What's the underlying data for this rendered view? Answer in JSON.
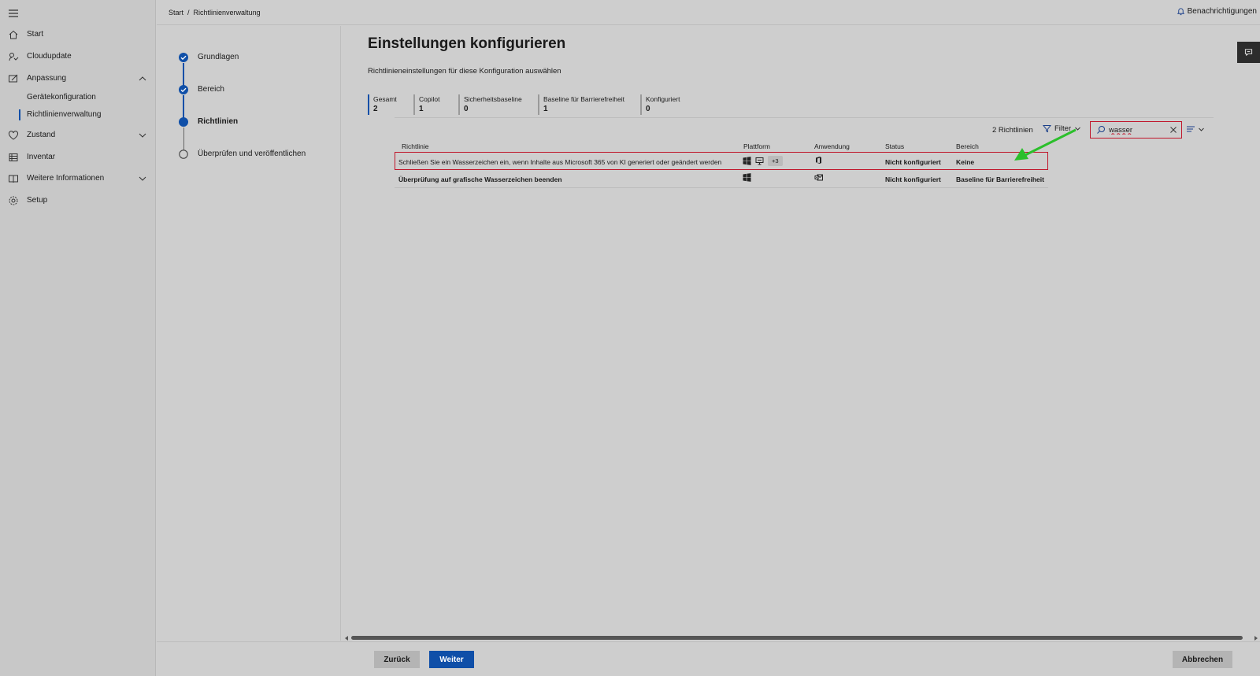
{
  "nav": {
    "items": [
      {
        "label": "Start",
        "icon": "home-icon"
      },
      {
        "label": "Cloudupdate",
        "icon": "cloud-update-icon"
      },
      {
        "label": "Anpassung",
        "icon": "customize-icon",
        "expanded": true
      },
      {
        "label": "Zustand",
        "icon": "health-icon",
        "expanded": false
      },
      {
        "label": "Inventar",
        "icon": "inventory-icon"
      },
      {
        "label": "Weitere Informationen",
        "icon": "book-icon",
        "expanded": false
      },
      {
        "label": "Setup",
        "icon": "gear-icon"
      }
    ],
    "subitems": [
      {
        "label": "Gerätekonfiguration"
      },
      {
        "label": "Richtlinienverwaltung",
        "selected": true
      }
    ]
  },
  "header": {
    "breadcrumb": [
      "Start",
      "Richtlinienverwaltung"
    ],
    "breadcrumb_sep": "/",
    "notifications_label": "Benachrichtigungen"
  },
  "steps": [
    {
      "label": "Grundlagen",
      "state": "done"
    },
    {
      "label": "Bereich",
      "state": "done"
    },
    {
      "label": "Richtlinien",
      "state": "current"
    },
    {
      "label": "Überprüfen und veröffentlichen",
      "state": "pending"
    }
  ],
  "main": {
    "title": "Einstellungen konfigurieren",
    "subtitle": "Richtlinieneinstellungen für diese Konfiguration auswählen",
    "tabs": [
      {
        "label": "Gesamt",
        "count": "2",
        "active": true
      },
      {
        "label": "Copilot",
        "count": "1"
      },
      {
        "label": "Sicherheitsbaseline",
        "count": "0"
      },
      {
        "label": "Baseline für Barrierefreiheit",
        "count": "1"
      },
      {
        "label": "Konfiguriert",
        "count": "0"
      }
    ],
    "toolbar": {
      "count_label": "2 Richtlinien",
      "filter_label": "Filter",
      "search_value": "wasser"
    },
    "table": {
      "headers": [
        "Richtlinie",
        "Plattform",
        "Anwendung",
        "Status",
        "Bereich"
      ],
      "rows": [
        {
          "policy": "Schließen Sie ein Wasserzeichen ein, wenn Inhalte aus Microsoft 365 von KI generiert oder geändert werden",
          "platform_extra": "+3",
          "status": "Nicht konfiguriert",
          "scope": "Keine",
          "highlight": true
        },
        {
          "policy": "Überprüfung auf grafische Wasserzeichen beenden",
          "platform_extra": "",
          "status": "Nicht konfiguriert",
          "scope": "Baseline für Barrierefreiheit",
          "highlight": false
        }
      ]
    }
  },
  "footer": {
    "back_label": "Zurück",
    "next_label": "Weiter",
    "cancel_label": "Abbrechen"
  },
  "colors": {
    "accent": "#0f4fa8",
    "highlight_border": "#c0152a",
    "annotation_arrow": "#2bbf2b"
  }
}
